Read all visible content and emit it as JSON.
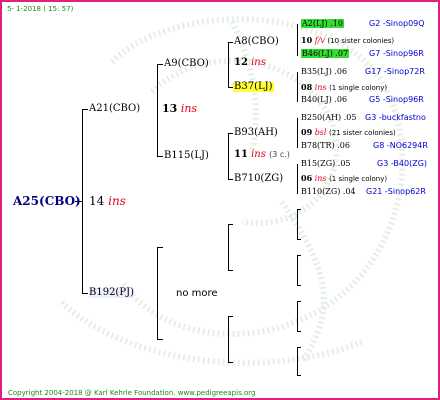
{
  "header": {
    "date": "5-  1-2018 ( 15: 57)"
  },
  "footer": {
    "copyright": "Copyright 2004-2018 @ Karl Kehrle Foundation.",
    "site": "www.pedigreeapis.org"
  },
  "colors": {
    "frame": "#e0207a",
    "header_text": "#1a8a1a",
    "link_blue": "#0000cc",
    "ins_red": "#e0001a",
    "highlight_yellow": "#ffff33",
    "highlight_green": "#33dd33"
  },
  "root": {
    "label": "A25(CBO)",
    "year": "14",
    "ins": "ins"
  },
  "gen1": {
    "upper": {
      "label": "A21(CBO)",
      "year": "13",
      "ins": "ins"
    },
    "lower": {
      "label": "B192(PJ)",
      "note": "no more"
    }
  },
  "gen2": {
    "a9": {
      "label": "A9(CBO)",
      "year": "12",
      "ins": "ins"
    },
    "b115": {
      "label": "B115(LJ)",
      "year": "11",
      "ins": "ins",
      "extra": "(3 c.)"
    }
  },
  "gen3": {
    "a8": {
      "label": "A8(CBO)"
    },
    "b37": {
      "label": "B37(LJ)"
    },
    "b93": {
      "label": "B93(AH)"
    },
    "b710": {
      "label": "B710(ZG)"
    }
  },
  "gen4": [
    {
      "name": "A2(LJ)",
      "year": ".10",
      "link": "G2 -Sinop09Q"
    },
    {
      "year": "10",
      "ins": "f/v",
      "note": "(10 sister colonies)"
    },
    {
      "name": "B46(LJ)",
      "year": ".07",
      "link": "G7 -Sinop96R"
    },
    {
      "name": "B35(LJ)",
      "year": ".06",
      "link": "G17 -Sinop72R"
    },
    {
      "year": "08",
      "ins": "ins",
      "note": "(1 single colony)"
    },
    {
      "name": "B40(LJ)",
      "year": ".06",
      "link": "G5 -Sinop96R"
    },
    {
      "name": "B250(AH)",
      "year": ".05",
      "link": "G3 -buckfastno"
    },
    {
      "year": "09",
      "ins": "bsl",
      "note": "(21 sister colonies)"
    },
    {
      "name": "B78(TR)",
      "year": ".06",
      "link": "G8 -NO6294R"
    },
    {
      "name": "B15(ZG)",
      "year": ".05",
      "link": "G3 -B40(ZG)"
    },
    {
      "year": "06",
      "ins": "ins",
      "note": "(1 single colony)"
    },
    {
      "name": "B110(ZG)",
      "year": ".04",
      "link": "G21 -Sinop62R"
    }
  ]
}
